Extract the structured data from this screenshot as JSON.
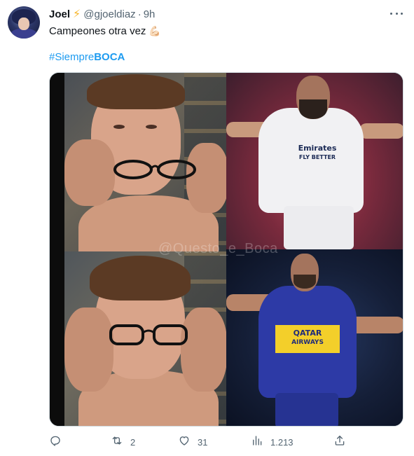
{
  "tweet": {
    "author_name": "Joel",
    "verified_emoji": "⚡",
    "handle": "@gjoeldiaz",
    "separator": "·",
    "time": "9h",
    "text": "Campeones otra vez",
    "text_emoji": "💪🏻",
    "hashtag_prefix": "#Siempre",
    "hashtag_bold": "BOCA",
    "media_watermark": "@Questo_e_Boca",
    "sponsor_top_right": "Emirates\nFLY BETTER",
    "sponsor_bottom_right": "QATAR\nAIRWAYS"
  },
  "actions": {
    "reply": {
      "icon": "reply-icon",
      "count": ""
    },
    "retweet": {
      "icon": "retweet-icon",
      "count": "2"
    },
    "like": {
      "icon": "heart-icon",
      "count": "31"
    },
    "views": {
      "icon": "views-icon",
      "count": "1.213"
    },
    "share": {
      "icon": "share-icon",
      "count": ""
    }
  },
  "colors": {
    "link": "#1d9bf0",
    "secondary_text": "#536471",
    "primary_text": "#0f1419",
    "bolt": "#f7b529"
  }
}
